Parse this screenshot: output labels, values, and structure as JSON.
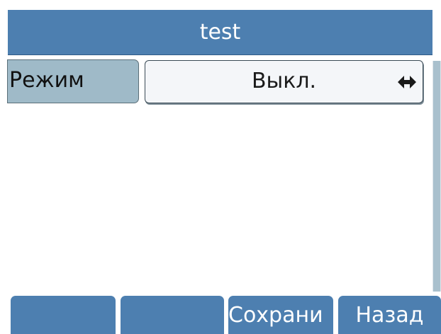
{
  "header": {
    "title": "test"
  },
  "setting": {
    "label": "Режим",
    "value": "Выкл.",
    "selector_icon": "left-right-arrows-icon"
  },
  "softkeys": [
    {
      "label": ""
    },
    {
      "label": ""
    },
    {
      "label": "Сохрани"
    },
    {
      "label": "Назад"
    }
  ],
  "colors": {
    "title_bar": "#4d7fb0",
    "label_bg": "#9fbac8",
    "value_bg": "#f4f6f9",
    "softkey_bg": "#4d7fb0"
  }
}
